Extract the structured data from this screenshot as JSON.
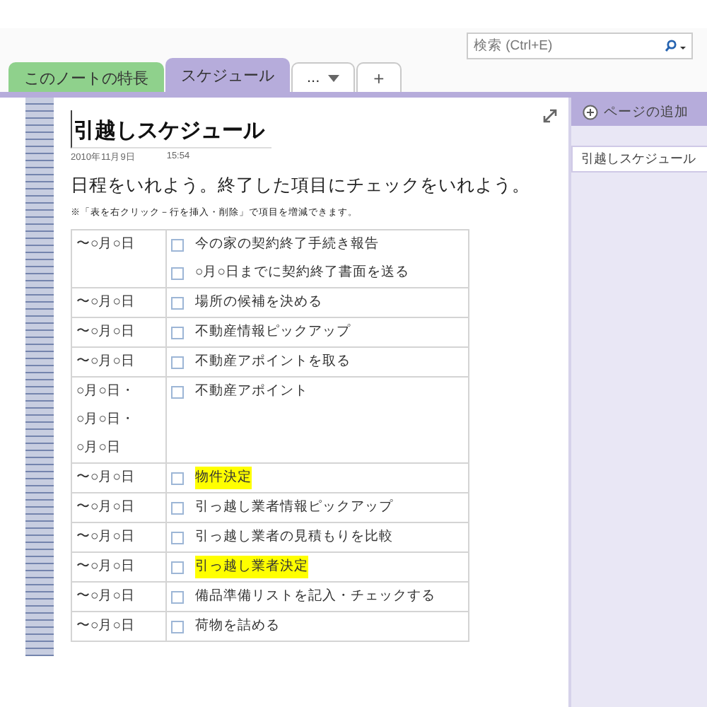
{
  "tabs": [
    {
      "label": "このノートの特長",
      "selected": false,
      "color": "#8fd18c"
    },
    {
      "label": "スケジュール",
      "selected": true,
      "color": "#b6acdb"
    },
    {
      "label": "...",
      "selected": false,
      "kind": "menu"
    },
    {
      "label": "+",
      "selected": false,
      "kind": "add"
    }
  ],
  "search": {
    "placeholder": "検索 (Ctrl+E)"
  },
  "page": {
    "title": "引越しスケジュール",
    "date": "2010年11月9日",
    "time": "15:54",
    "intro": "日程をいれよう。終了した項目にチェックをいれよう。",
    "note": "※「表を右クリック－行を挿入・削除」で項目を増減できます。"
  },
  "table": {
    "rows": [
      {
        "date": [
          "〜○月○日"
        ],
        "tasks": [
          {
            "text": "今の家の契約終了手続き報告",
            "checked": false,
            "highlighted": false
          },
          {
            "text": "○月○日までに契約終了書面を送る",
            "checked": false,
            "highlighted": false
          }
        ]
      },
      {
        "date": [
          "〜○月○日"
        ],
        "tasks": [
          {
            "text": "場所の候補を決める",
            "checked": false,
            "highlighted": false
          }
        ]
      },
      {
        "date": [
          "〜○月○日"
        ],
        "tasks": [
          {
            "text": "不動産情報ピックアップ",
            "checked": false,
            "highlighted": false
          }
        ]
      },
      {
        "date": [
          "〜○月○日"
        ],
        "tasks": [
          {
            "text": "不動産アポイントを取る",
            "checked": false,
            "highlighted": false
          }
        ]
      },
      {
        "date": [
          "○月○日・",
          "○月○日・",
          "○月○日"
        ],
        "tasks": [
          {
            "text": " 不動産アポイント",
            "checked": false,
            "highlighted": false
          }
        ]
      },
      {
        "date": [
          "〜○月○日"
        ],
        "tasks": [
          {
            "text": "物件決定",
            "checked": false,
            "highlighted": true
          }
        ]
      },
      {
        "date": [
          "〜○月○日"
        ],
        "tasks": [
          {
            "text": "引っ越し業者情報ピックアップ",
            "checked": false,
            "highlighted": false
          }
        ]
      },
      {
        "date": [
          "〜○月○日"
        ],
        "tasks": [
          {
            "text": "引っ越し業者の見積もりを比較",
            "checked": false,
            "highlighted": false
          }
        ]
      },
      {
        "date": [
          "〜○月○日"
        ],
        "tasks": [
          {
            "text": "引っ越し業者決定",
            "checked": false,
            "highlighted": true
          }
        ]
      },
      {
        "date": [
          "〜○月○日"
        ],
        "tasks": [
          {
            "text": "備品準備リストを記入・チェックする",
            "checked": false,
            "highlighted": false
          }
        ]
      },
      {
        "date": [
          "〜○月○日"
        ],
        "tasks": [
          {
            "text": "荷物を詰める",
            "checked": false,
            "highlighted": false
          }
        ]
      }
    ]
  },
  "sidebar": {
    "add_page": "ページの追加",
    "pages": [
      {
        "label": "引越しスケジュール",
        "selected": true
      }
    ]
  }
}
